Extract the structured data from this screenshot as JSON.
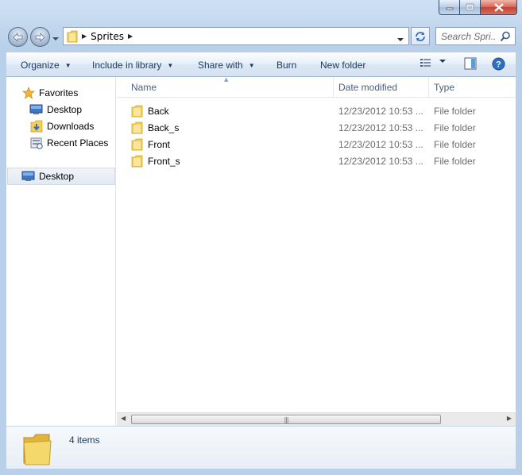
{
  "window": {
    "caption_buttons": [
      "minimize",
      "maximize",
      "close"
    ]
  },
  "address_bar": {
    "path": [
      "Sprites"
    ],
    "search_placeholder": "Search Spri..."
  },
  "toolbar": {
    "organize": "Organize",
    "include_in_library": "Include in library",
    "share_with": "Share with",
    "burn": "Burn",
    "new_folder": "New folder"
  },
  "nav_pane": {
    "favorites": "Favorites",
    "items": [
      "Desktop",
      "Downloads",
      "Recent Places"
    ],
    "desktop_root": "Desktop"
  },
  "columns": {
    "name": "Name",
    "date_modified": "Date modified",
    "type": "Type"
  },
  "files": [
    {
      "name": "Back",
      "date": "12/23/2012 10:53 ...",
      "type": "File folder"
    },
    {
      "name": "Back_s",
      "date": "12/23/2012 10:53 ...",
      "type": "File folder"
    },
    {
      "name": "Front",
      "date": "12/23/2012 10:53 ...",
      "type": "File folder"
    },
    {
      "name": "Front_s",
      "date": "12/23/2012 10:53 ...",
      "type": "File folder"
    }
  ],
  "details": {
    "count": "4 items"
  },
  "colors": {
    "frame": "#b8d0ea",
    "folder_yellow": "#f2cf5b",
    "link_text": "#1e395b"
  }
}
